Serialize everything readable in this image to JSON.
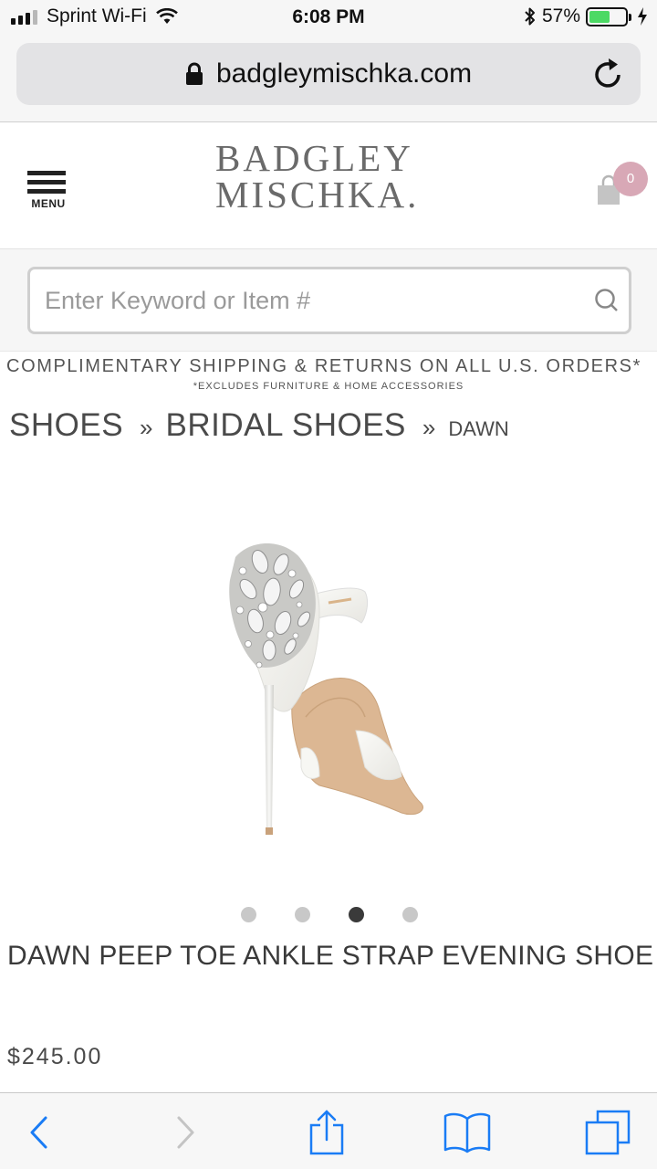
{
  "status_bar": {
    "carrier": "Sprint Wi-Fi",
    "time": "6:08 PM",
    "battery_percent": "57%",
    "battery_level": 0.57
  },
  "browser": {
    "url": "badgleymischka.com"
  },
  "header": {
    "logo_line1": "BADGLEY",
    "logo_line2": "MISCHKA.",
    "menu_label": "MENU",
    "cart_count": "0",
    "accent_color": "#d8a8b6"
  },
  "search": {
    "placeholder": "Enter Keyword or Item #",
    "value": ""
  },
  "promo": {
    "main": "COMPLIMENTARY SHIPPING & RETURNS ON ALL U.S. ORDERS*",
    "sub": "*EXCLUDES FURNITURE & HOME ACCESSORIES"
  },
  "breadcrumb": {
    "items": [
      "SHOES",
      "BRIDAL SHOES",
      "DAWN"
    ],
    "separator": "»"
  },
  "product": {
    "title": "DAWN PEEP TOE ANKLE STRAP EVENING SHOE",
    "price": "$245.00",
    "image_count": 4,
    "active_image_index": 3
  }
}
